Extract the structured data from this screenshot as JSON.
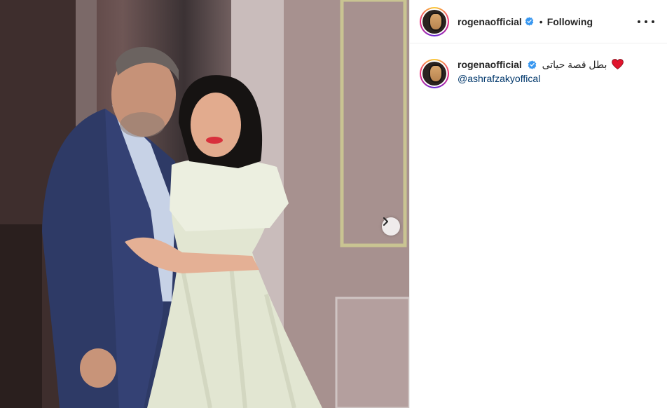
{
  "post": {
    "username": "rogenaofficial",
    "separator": "•",
    "follow_status": "Following",
    "more_icon": "more-options-icon",
    "verified_icon": "verified-badge-icon",
    "verified_color": "#3897f0",
    "caption": {
      "username": "rogenaofficial",
      "text": "بطل قصة حياتى",
      "emoji_icon": "red-heart-icon",
      "mention": "@ashrafzakyoffical"
    },
    "next_icon": "chevron-right-icon",
    "link_color": "#00376b"
  }
}
